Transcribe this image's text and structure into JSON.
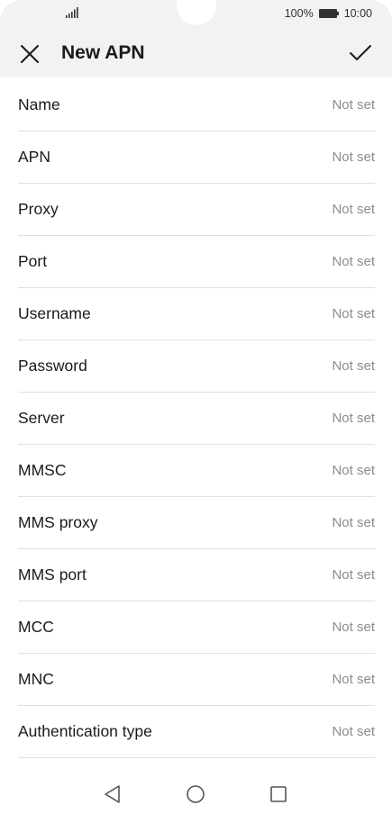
{
  "status_bar": {
    "battery_percent": "100%",
    "time": "10:00",
    "icons": [
      "signal-icon",
      "battery-icon"
    ]
  },
  "toolbar": {
    "title": "New APN",
    "close_icon": "close-icon",
    "save_icon": "checkmark-icon"
  },
  "fields": [
    {
      "label": "Name",
      "value": "Not set"
    },
    {
      "label": "APN",
      "value": "Not set"
    },
    {
      "label": "Proxy",
      "value": "Not set"
    },
    {
      "label": "Port",
      "value": "Not set"
    },
    {
      "label": "Username",
      "value": "Not set"
    },
    {
      "label": "Password",
      "value": "Not set"
    },
    {
      "label": "Server",
      "value": "Not set"
    },
    {
      "label": "MMSC",
      "value": "Not set"
    },
    {
      "label": "MMS proxy",
      "value": "Not set"
    },
    {
      "label": "MMS port",
      "value": "Not set"
    },
    {
      "label": "MCC",
      "value": "Not set"
    },
    {
      "label": "MNC",
      "value": "Not set"
    },
    {
      "label": "Authentication type",
      "value": "Not set"
    }
  ],
  "nav_bar": {
    "icons": [
      "back-icon",
      "home-icon",
      "recents-icon"
    ]
  }
}
